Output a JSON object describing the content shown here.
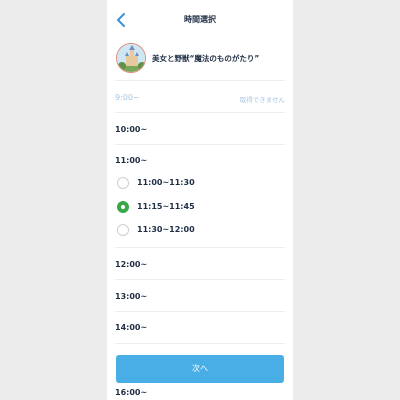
{
  "header": {
    "title": "時間選択",
    "back_icon": "chevron-left-icon"
  },
  "attraction": {
    "name": "美女と野獣“魔法のものがたり”",
    "thumbnail_icon": "castle-photo"
  },
  "slots": {
    "h0900": {
      "label": "9:00~",
      "status": "取得できません"
    },
    "h1000": {
      "label": "10:00~"
    },
    "h1100": {
      "label": "11:00~"
    },
    "h1200": {
      "label": "12:00~"
    },
    "h1300": {
      "label": "13:00~"
    },
    "h1400": {
      "label": "14:00~"
    },
    "h1600": {
      "label": "16:00~"
    }
  },
  "options": [
    {
      "label": "11:00~11:30",
      "selected": false
    },
    {
      "label": "11:15~11:45",
      "selected": true
    },
    {
      "label": "11:30~12:00",
      "selected": false
    }
  ],
  "next_button": {
    "label": "次へ"
  },
  "colors": {
    "accent": "#4aaee6",
    "selected": "#3aa84a",
    "text": "#1f2f46",
    "disabled": "#a9c4e3",
    "back": "#3a8fd8"
  }
}
